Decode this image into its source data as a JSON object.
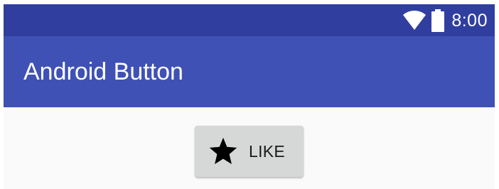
{
  "status_bar": {
    "time": "8:00",
    "icons": [
      "wifi-icon",
      "battery-icon"
    ]
  },
  "app_bar": {
    "title": "Android Button"
  },
  "content": {
    "like_button": {
      "label": "LIKE",
      "icon": "star-icon"
    }
  },
  "colors": {
    "status_bar": "#303f9f",
    "app_bar": "#3f51b5",
    "background": "#fafafa",
    "button": "#d6d7d7"
  }
}
